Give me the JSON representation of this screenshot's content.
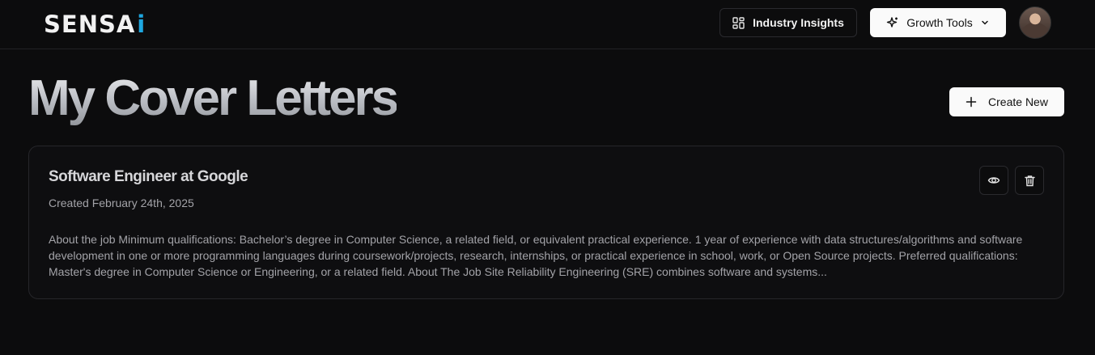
{
  "header": {
    "logo_main": "SENSA",
    "logo_accent": "i",
    "insights_label": "Industry Insights",
    "growth_label": "Growth Tools"
  },
  "page": {
    "title": "My Cover Letters",
    "create_label": "Create New"
  },
  "letters": [
    {
      "title": "Software Engineer at Google",
      "created": "Created February 24th, 2025",
      "description": "About the job Minimum qualifications: Bachelor’s degree in Computer Science, a related field, or equivalent practical experience. 1 year of experience with data structures/algorithms and software development in one or more programming languages during coursework/projects, research, internships, or practical experience in school, work, or Open Source projects. Preferred qualifications: Master's degree in Computer Science or Engineering, or a related field. About The Job Site Reliability Engineering (SRE) combines software and systems..."
    }
  ],
  "colors": {
    "background": "#0c0c0d",
    "logo_accent": "#1ea7e0",
    "button_light": "#fafafa"
  },
  "icons": {
    "insights": "grid-icon",
    "growth": "sparkles-icon",
    "dropdown": "chevron-down-icon",
    "create": "plus-icon",
    "view": "eye-icon",
    "delete": "trash-icon"
  }
}
